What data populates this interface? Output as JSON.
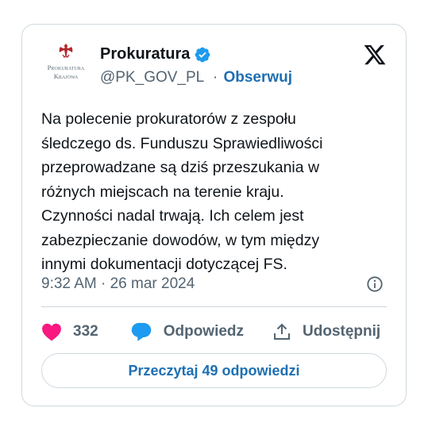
{
  "account": {
    "name": "Prokuratura",
    "handle": "@PK_GOV_PL",
    "separator": "·",
    "follow_label": "Obserwuj",
    "logo_line1": "Prokuratura",
    "logo_line2": "Krajowa"
  },
  "tweet": {
    "lines": [
      "Na polecenie prokuratorów z zespołu",
      "śledczego ds. Funduszu Sprawiedliwości",
      "przeprowadzane są dziś przeszukania w",
      "różnych miejscach na terenie kraju.",
      "Czynności nadal trwają. Ich celem jest",
      "zabezpieczanie dowodów, w tym między",
      "innymi dokumentacji dotyczącej FS."
    ],
    "timestamp": "9:32 AM · 26 mar 2024"
  },
  "actions": {
    "like_count": "332",
    "reply_label": "Odpowiedz",
    "share_label": "Udostępnij"
  },
  "read_replies_label": "Przeczytaj 49 odpowiedzi",
  "icons": {
    "logo": "eagle-emblem-icon",
    "verified": "verified-badge-icon",
    "brand": "x-logo-icon",
    "info": "info-icon",
    "like": "heart-icon",
    "reply": "speech-bubble-icon",
    "share": "share-upload-icon"
  },
  "colors": {
    "verified": "#1d9bf0",
    "link": "#1d6fb3",
    "like": "#f91880",
    "reply": "#1d9bf0",
    "text": "#0f1419",
    "muted": "#536471",
    "border": "#cfd9de"
  }
}
